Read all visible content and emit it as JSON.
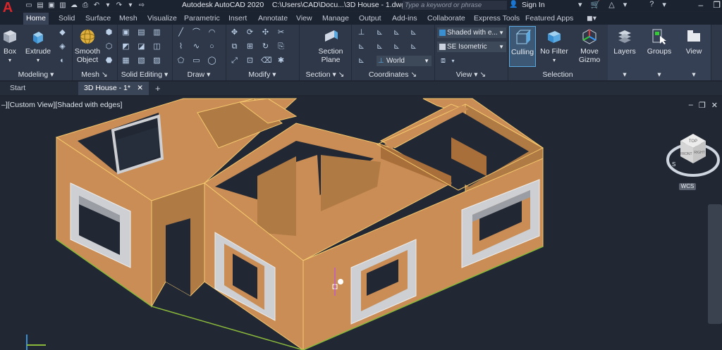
{
  "title_bar": {
    "app_title": "Autodesk AutoCAD 2020",
    "file_path": "C:\\Users\\CAD\\Docu...\\3D House - 1.dwg",
    "search_placeholder": "Type a keyword or phrase",
    "sign_in": "Sign In",
    "logo_letter": "A"
  },
  "ribbon_tabs": [
    "Home",
    "Solid",
    "Surface",
    "Mesh",
    "Visualize",
    "Parametric",
    "Insert",
    "Annotate",
    "View",
    "Manage",
    "Output",
    "Add-ins",
    "Collaborate",
    "Express Tools",
    "Featured Apps"
  ],
  "panels": {
    "modeling": {
      "title": "Modeling",
      "box": "Box",
      "extrude": "Extrude"
    },
    "mesh": {
      "title": "Mesh",
      "smooth_object": "Smooth\nObject"
    },
    "solid_editing": {
      "title": "Solid Editing"
    },
    "draw": {
      "title": "Draw"
    },
    "modify": {
      "title": "Modify"
    },
    "section": {
      "title": "Section",
      "section_plane": "Section\nPlane"
    },
    "coordinates": {
      "title": "Coordinates",
      "world": "World"
    },
    "view": {
      "title": "View",
      "visual_style": "Shaded with e...",
      "view_preset": "SE Isometric"
    },
    "selection": {
      "title": "Selection",
      "culling": "Culling",
      "no_filter": "No Filter",
      "move_gizmo": "Move\nGizmo"
    },
    "layers": {
      "label": "Layers"
    },
    "groups": {
      "label": "Groups"
    },
    "view2": {
      "label": "View"
    }
  },
  "file_tabs": {
    "start": "Start",
    "doc": "3D House - 1*"
  },
  "viewport": {
    "label": "–][Custom View][Shaded with edges]",
    "wcs": "WCS",
    "cube_top": "TOP",
    "cube_front": "FRONT",
    "cube_right": "RIGHT",
    "compass_s": "S"
  },
  "colors": {
    "accent": "#d9262b",
    "wall": "#c98d55",
    "wall_dark": "#9a6a3c",
    "edge": "#f5c96e",
    "background": "#212834"
  }
}
